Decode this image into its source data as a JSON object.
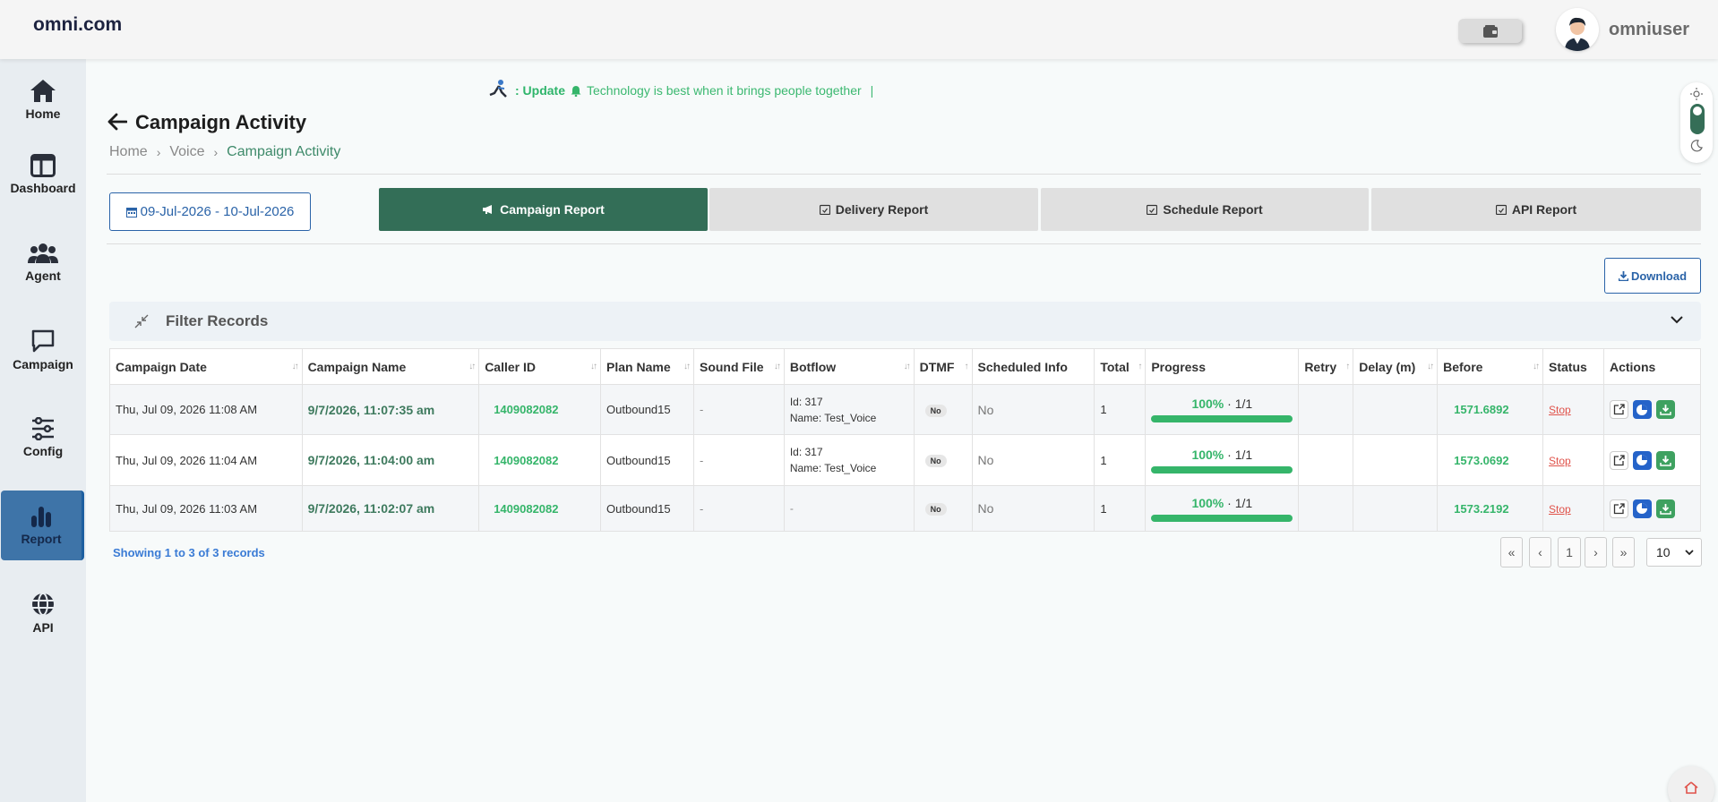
{
  "header": {
    "brand": "omni.com",
    "username": "omniuser"
  },
  "sidebar": {
    "items": [
      {
        "label": "Home",
        "icon": "home-icon"
      },
      {
        "label": "Dashboard",
        "icon": "dashboard-icon"
      },
      {
        "label": "Agent",
        "icon": "agent-icon"
      },
      {
        "label": "Campaign",
        "icon": "chat-icon"
      },
      {
        "label": "Config",
        "icon": "sliders-icon"
      },
      {
        "label": "Report",
        "icon": "bar-chart-icon",
        "active": true
      },
      {
        "label": "API",
        "icon": "globe-icon"
      }
    ]
  },
  "ticker": {
    "prefix": ": Update",
    "text": "Technology is best when it brings people together",
    "suffix": "|"
  },
  "page": {
    "title": "Campaign Activity",
    "breadcrumb": [
      "Home",
      "Voice",
      "Campaign Activity"
    ]
  },
  "date_range": "09-Jul-2026 - 10-Jul-2026",
  "tabs": [
    {
      "label": "Campaign Report",
      "active": true
    },
    {
      "label": "Delivery Report"
    },
    {
      "label": "Schedule Report"
    },
    {
      "label": "API Report"
    }
  ],
  "download_label": "Download",
  "filter": {
    "title": "Filter Records"
  },
  "table": {
    "columns": [
      "Campaign Date",
      "Campaign Name",
      "Caller ID",
      "Plan Name",
      "Sound File",
      "Botflow",
      "DTMF",
      "Scheduled Info",
      "Total",
      "Progress",
      "Retry",
      "Delay (m)",
      "Before",
      "Status",
      "Actions"
    ],
    "rows": [
      {
        "date": "Thu, Jul 09, 2026 11:08 AM",
        "name": "9/7/2026, 11:07:35 am",
        "caller_id": "1409082082",
        "plan": "Outbound15",
        "sound": "-",
        "bot_id": "Id: 317",
        "bot_name": "Name: Test_Voice",
        "dtmf": "No",
        "scheduled": "No",
        "total": "1",
        "progress_pct": "100%",
        "progress_count": "· 1/1",
        "progress_fraction": 1.0,
        "retry": "",
        "delay": "",
        "before": "1571.6892",
        "status": "Stop"
      },
      {
        "date": "Thu, Jul 09, 2026 11:04 AM",
        "name": "9/7/2026, 11:04:00 am",
        "caller_id": "1409082082",
        "plan": "Outbound15",
        "sound": "-",
        "bot_id": "Id: 317",
        "bot_name": "Name: Test_Voice",
        "dtmf": "No",
        "scheduled": "No",
        "total": "1",
        "progress_pct": "100%",
        "progress_count": "· 1/1",
        "progress_fraction": 1.0,
        "retry": "",
        "delay": "",
        "before": "1573.0692",
        "status": "Stop"
      },
      {
        "date": "Thu, Jul 09, 2026 11:03 AM",
        "name": "9/7/2026, 11:02:07 am",
        "caller_id": "1409082082",
        "plan": "Outbound15",
        "sound": "-",
        "bot_id": "-",
        "bot_name": "",
        "dtmf": "No",
        "scheduled": "No",
        "total": "1",
        "progress_pct": "100%",
        "progress_count": "· 1/1",
        "progress_fraction": 1.0,
        "retry": "",
        "delay": "",
        "before": "1573.2192",
        "status": "Stop"
      }
    ]
  },
  "footer": {
    "showing": "Showing 1 to 3 of 3 records",
    "pager": [
      "«",
      "‹",
      "1",
      "›",
      "»"
    ],
    "page_size": "10"
  },
  "colors": {
    "accent": "#336e57",
    "link": "#2a63a8",
    "success": "#35b56a",
    "danger": "#e0534b"
  }
}
